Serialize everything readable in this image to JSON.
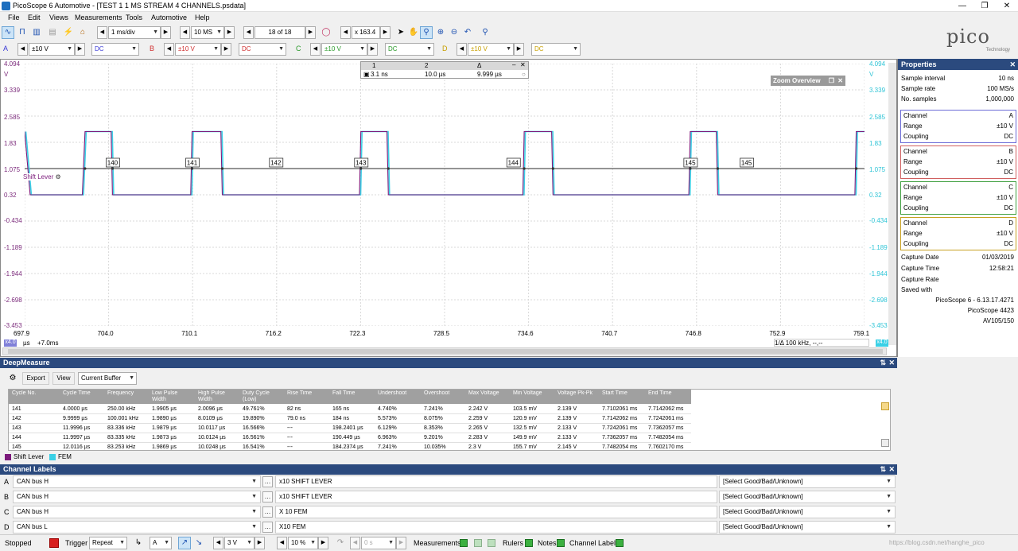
{
  "window": {
    "title": "PicoScope 6 Automotive - [TEST 1 1 MS STREAM 4 CHANNELS.psdata]"
  },
  "menu": [
    "File",
    "Edit",
    "Views",
    "Measurements",
    "Tools",
    "Automotive",
    "Help"
  ],
  "toolbar1": {
    "timebase": "1 ms/div",
    "samples": "10 MS",
    "buffer": "18 of 18",
    "zoom": "x 163.4"
  },
  "channels_bar": [
    {
      "id": "A",
      "range": "±10 V",
      "coupling": "DC",
      "color": "#3a3ad6"
    },
    {
      "id": "B",
      "range": "±10 V",
      "coupling": "DC",
      "color": "#d03030"
    },
    {
      "id": "C",
      "range": "±10 V",
      "coupling": "DC",
      "color": "#2a9a2a"
    },
    {
      "id": "D",
      "range": "±10 V",
      "coupling": "DC",
      "color": "#c8a000"
    }
  ],
  "logo": {
    "text": "pico",
    "sub": "Technology"
  },
  "scope": {
    "y_left_ticks": [
      "4.094",
      "V",
      "3.339",
      "2.585",
      "1.83",
      "1.075",
      "0.32",
      "-0.434",
      "-1.189",
      "-1.944",
      "-2.698",
      "-3.453"
    ],
    "y_right_ticks": [
      "4.094",
      "V",
      "3.339",
      "2.585",
      "1.83",
      "1.075",
      "0.32",
      "-0.434",
      "-1.189",
      "-1.944",
      "-2.698",
      "-3.453"
    ],
    "x_ticks": [
      "697.9",
      "704.0",
      "710.1",
      "716.2",
      "722.3",
      "728.5",
      "734.6",
      "740.7",
      "746.8",
      "752.9",
      "759.1"
    ],
    "x_unit": "µs",
    "x_offset": "+7.0ms",
    "x_zoom_label": "x4.0",
    "shift_label": "Shift Lever",
    "cycle_markers": [
      "140",
      "141",
      "142",
      "143",
      "144",
      "145",
      "145"
    ],
    "ruler": {
      "h1": "1",
      "h2": "2",
      "h3": "Δ",
      "v1": "3.1 ns",
      "v2": "10.0 µs",
      "v3": "9.999 µs"
    },
    "zoom_overview": "Zoom Overview",
    "freq_readout": "1/Δ  100 kHz, --,--"
  },
  "properties": {
    "title": "Properties",
    "rows": [
      {
        "k": "Sample interval",
        "v": "10 ns"
      },
      {
        "k": "Sample rate",
        "v": "100 MS/s"
      },
      {
        "k": "No. samples",
        "v": "1,000,000"
      }
    ],
    "channels": [
      {
        "ch": "A",
        "range": "±10 V",
        "coupling": "DC",
        "color": "#6a6ad6"
      },
      {
        "ch": "B",
        "range": "±10 V",
        "coupling": "DC",
        "color": "#d06060"
      },
      {
        "ch": "C",
        "range": "±10 V",
        "coupling": "DC",
        "color": "#40a040"
      },
      {
        "ch": "D",
        "range": "±10 V",
        "coupling": "DC",
        "color": "#c8a020"
      }
    ],
    "labels": {
      "channel": "Channel",
      "range": "Range",
      "coupling": "Coupling"
    },
    "capture": [
      {
        "k": "Capture Date",
        "v": "01/03/2019"
      },
      {
        "k": "Capture Time",
        "v": "12:58:21"
      },
      {
        "k": "Capture Rate",
        "v": ""
      },
      {
        "k": "Saved with",
        "v": ""
      }
    ],
    "saved_with": [
      "PicoScope 6 - 6.13.17.4271",
      "PicoScope 4423",
      "AV105/150"
    ]
  },
  "deep": {
    "title": "DeepMeasure",
    "export": "Export",
    "view": "View",
    "buffer": "Current Buffer",
    "headers": [
      "Cycle No.",
      "Cycle Time",
      "Frequency",
      "Low Pulse Width",
      "High Pulse Width",
      "Duty Cycle (Low)",
      "Rise Time",
      "Fall Time",
      "Undershoot",
      "Overshoot",
      "Max Voltage",
      "Min Voltage",
      "Voltage Pk-Pk",
      "Start Time",
      "End Time"
    ],
    "rows": [
      [
        "141",
        "4.0000 µs",
        "250.00 kHz",
        "1.9905 µs",
        "2.0096 µs",
        "49.761%",
        "82 ns",
        "165 ns",
        "4.740%",
        "7.241%",
        "2.242 V",
        "103.5 mV",
        "2.139 V",
        "7.7102061 ms",
        "7.7142062 ms"
      ],
      [
        "142",
        "9.9999 µs",
        "100.001 kHz",
        "1.9890 µs",
        "8.0109 µs",
        "19.890%",
        "79.0 ns",
        "184 ns",
        "5.573%",
        "8.075%",
        "2.259 V",
        "120.9 mV",
        "2.139 V",
        "7.7142062 ms",
        "7.7242061 ms"
      ],
      [
        "143",
        "11.9996 µs",
        "83.336 kHz",
        "1.9879 µs",
        "10.0117 µs",
        "16.566%",
        "---",
        "198.2401 µs",
        "6.129%",
        "8.353%",
        "2.265 V",
        "132.5 mV",
        "2.133 V",
        "7.7242061 ms",
        "7.7362057 ms"
      ],
      [
        "144",
        "11.9997 µs",
        "83.335 kHz",
        "1.9873 µs",
        "10.0124 µs",
        "16.561%",
        "---",
        "190.449 µs",
        "6.963%",
        "9.201%",
        "2.283 V",
        "149.9 mV",
        "2.133 V",
        "7.7362057 ms",
        "7.7482054 ms"
      ],
      [
        "145",
        "12.0116 µs",
        "83.253 kHz",
        "1.9869 µs",
        "10.0248 µs",
        "16.541%",
        "---",
        "184.2374 µs",
        "7.241%",
        "10.035%",
        "2.3 V",
        "155.7 mV",
        "2.145 V",
        "7.7482054 ms",
        "7.7602170 ms"
      ]
    ],
    "legend": [
      {
        "name": "Shift Lever",
        "color": "#7b1a7b"
      },
      {
        "name": "FEM",
        "color": "#3ad0e6"
      }
    ]
  },
  "chlabels": {
    "title": "Channel Labels",
    "rows": [
      {
        "ch": "A",
        "bus": "CAN bus H",
        "label": "x10 SHIFT LEVER",
        "status": "[Select Good/Bad/Unknown]"
      },
      {
        "ch": "B",
        "bus": "CAN bus H",
        "label": "x10 SHIFT LEVER",
        "status": "[Select Good/Bad/Unknown]"
      },
      {
        "ch": "C",
        "bus": "CAN bus H",
        "label": "X 10 FEM",
        "status": "[Select Good/Bad/Unknown]"
      },
      {
        "ch": "D",
        "bus": "CAN bus L",
        "label": "X10 FEM",
        "status": "[Select Good/Bad/Unknown]"
      }
    ]
  },
  "status": {
    "stopped": "Stopped",
    "trigger": "Trigger",
    "mode": "Repeat",
    "channel": "A",
    "level": "3 V",
    "pre": "10 %",
    "delay": "0 s",
    "measurements": "Measurements",
    "rulers": "Rulers",
    "notes": "Notes",
    "channel_labels": "Channel Labels",
    "watermark": "https://blog.csdn.net/hanghe_pico"
  },
  "waveform": {
    "high_v": 2.139,
    "low_v": 0.32,
    "edges_us": [
      [
        697.9,
        "H"
      ],
      [
        698.3,
        "L"
      ],
      [
        702.1,
        "L"
      ],
      [
        702.3,
        "H"
      ],
      [
        704.2,
        "H"
      ],
      [
        704.3,
        "L"
      ],
      [
        710.0,
        "L"
      ],
      [
        710.1,
        "H"
      ],
      [
        712.2,
        "H"
      ],
      [
        712.3,
        "L"
      ],
      [
        722.3,
        "L"
      ],
      [
        722.4,
        "H"
      ],
      [
        724.3,
        "H"
      ],
      [
        724.4,
        "L"
      ],
      [
        734.2,
        "L"
      ],
      [
        734.3,
        "H"
      ],
      [
        736.3,
        "H"
      ],
      [
        736.4,
        "L"
      ],
      [
        746.3,
        "L"
      ],
      [
        746.4,
        "H"
      ],
      [
        748.3,
        "H"
      ],
      [
        748.4,
        "L"
      ],
      [
        758.4,
        "L"
      ],
      [
        758.5,
        "H"
      ],
      [
        759.1,
        "H"
      ]
    ]
  }
}
